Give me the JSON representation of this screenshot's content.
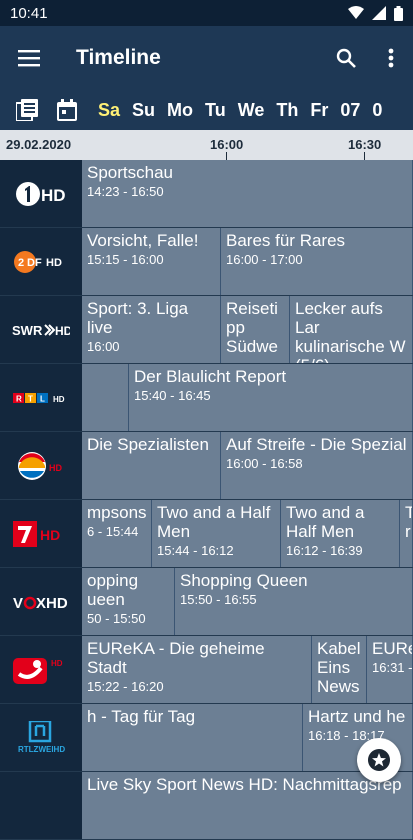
{
  "status": {
    "time": "10:41"
  },
  "app": {
    "title": "Timeline"
  },
  "days": [
    "Sa",
    "Su",
    "Mo",
    "Tu",
    "We",
    "Th",
    "Fr",
    "07",
    "0"
  ],
  "timebar": {
    "date": "29.02.2020",
    "times": [
      "16:00",
      "16:30"
    ]
  },
  "channels": [
    {
      "logo": "1HD",
      "programs": [
        {
          "title": "Sportschau",
          "time": "14:23 - 16:50"
        }
      ]
    },
    {
      "logo": "ZDFHD",
      "programs": [
        {
          "title": "Vorsicht, Falle!",
          "time": "15:15 - 16:00"
        },
        {
          "title": "Bares für Rares",
          "time": "16:00 - 17:00"
        }
      ]
    },
    {
      "logo": "SWR»HD",
      "programs": [
        {
          "title": "Sport: 3. Liga live",
          "time": "16:00"
        },
        {
          "title": "Reiseti pp Südwe",
          "time": ""
        },
        {
          "title": "Lecker aufs Lar kulinarische W (5/6)",
          "time": ""
        }
      ]
    },
    {
      "logo": "RTL HD",
      "programs": [
        {
          "title": "",
          "time": ""
        },
        {
          "title": "Der Blaulicht Report",
          "time": "15:40 - 16:45"
        }
      ]
    },
    {
      "logo": "SAT.1 HD",
      "programs": [
        {
          "title": "Die Spezialisten",
          "time": ""
        },
        {
          "title": "Auf Streife - Die Spezial",
          "time": "16:00 - 16:58"
        }
      ]
    },
    {
      "logo": "7HD",
      "programs": [
        {
          "title": "mpsons",
          "time": "6 - 15:44"
        },
        {
          "title": "Two and a Half Men",
          "time": "15:44 - 16:12"
        },
        {
          "title": "Two and a Half Men",
          "time": "16:12 - 16:39"
        },
        {
          "title": "T r",
          "time": ""
        }
      ]
    },
    {
      "logo": "VOXHD",
      "programs": [
        {
          "title": "opping ueen",
          "time": "50 - 15:50"
        },
        {
          "title": "Shopping Queen",
          "time": "15:50 - 16:55"
        }
      ]
    },
    {
      "logo": "kabel eins HD",
      "programs": [
        {
          "title": "EUReKA - Die geheime Stadt",
          "time": "15:22 - 16:20"
        },
        {
          "title": "Kabel Eins News",
          "time": ""
        },
        {
          "title": "EURe",
          "time": "16:31 -"
        }
      ]
    },
    {
      "logo": "RTLZWEI HD",
      "programs": [
        {
          "title": "h - Tag für Tag",
          "time": ""
        },
        {
          "title": "Hartz und he",
          "time": "16:18 - 18:17"
        }
      ]
    },
    {
      "logo": "",
      "programs": [
        {
          "title": "Live Sky Sport News HD: Nachmittagsrep",
          "time": ""
        }
      ]
    }
  ],
  "colors": {
    "background": "#3b5573",
    "appbar": "#1e3855",
    "selected_day": "#fff176",
    "program": "#6c7f94",
    "logo_bg": "#13273d"
  }
}
